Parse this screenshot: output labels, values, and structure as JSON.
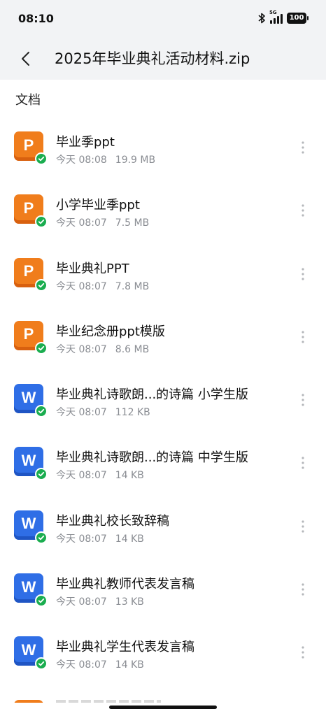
{
  "status_bar": {
    "time": "08:10",
    "network": "5G",
    "battery": "100"
  },
  "header": {
    "title": "2025年毕业典礼活动材料.zip"
  },
  "section": {
    "title": "文档"
  },
  "files": [
    {
      "name": "毕业季ppt",
      "date": "今天 08:08",
      "size": "19.9 MB",
      "type": "ppt",
      "letter": "P"
    },
    {
      "name": "小学毕业季ppt",
      "date": "今天 08:07",
      "size": "7.5 MB",
      "type": "ppt",
      "letter": "P"
    },
    {
      "name": "毕业典礼PPT",
      "date": "今天 08:07",
      "size": "7.8 MB",
      "type": "ppt",
      "letter": "P"
    },
    {
      "name": "毕业纪念册ppt模版",
      "date": "今天 08:07",
      "size": "8.6 MB",
      "type": "ppt",
      "letter": "P"
    },
    {
      "name": "毕业典礼诗歌朗...的诗篇 小学生版",
      "date": "今天 08:07",
      "size": "112 KB",
      "type": "doc",
      "letter": "W"
    },
    {
      "name": "毕业典礼诗歌朗...的诗篇 中学生版",
      "date": "今天 08:07",
      "size": "14 KB",
      "type": "doc",
      "letter": "W"
    },
    {
      "name": "毕业典礼校长致辞稿",
      "date": "今天 08:07",
      "size": "14 KB",
      "type": "doc",
      "letter": "W"
    },
    {
      "name": "毕业典礼教师代表发言稿",
      "date": "今天 08:07",
      "size": "13 KB",
      "type": "doc",
      "letter": "W"
    },
    {
      "name": "毕业典礼学生代表发言稿",
      "date": "今天 08:07",
      "size": "14 KB",
      "type": "doc",
      "letter": "W"
    }
  ],
  "colors": {
    "ppt": "#f07d1c",
    "doc": "#2f6ee6",
    "check": "#1aad4f",
    "header_bg": "#f2f3f5"
  },
  "icons": {
    "back": "chevron-left-icon",
    "more": "more-vertical-icon",
    "status": "check-icon"
  }
}
